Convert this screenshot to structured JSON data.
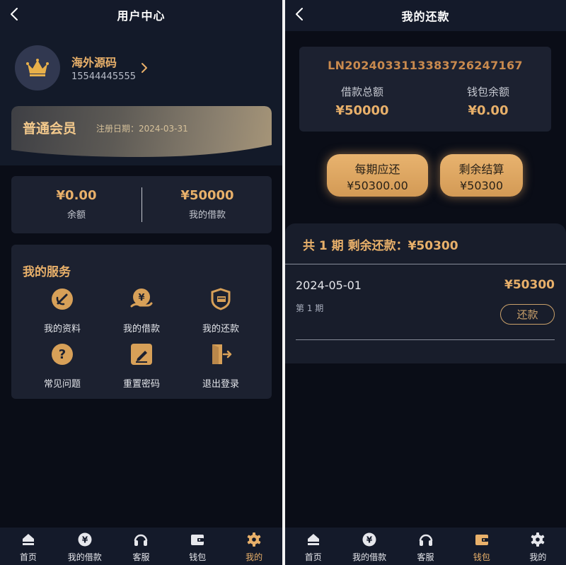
{
  "user_center": {
    "header": {
      "title": "用户中心"
    },
    "profile": {
      "name": "海外源码",
      "phone": "15544445555"
    },
    "membership": {
      "level": "普通会员",
      "reg_date": "注册日期：2024-03-31"
    },
    "balance": {
      "balance_value": "¥0.00",
      "balance_label": "余额",
      "loan_value": "¥50000",
      "loan_label": "我的借款"
    },
    "services": {
      "title": "我的服务",
      "items": [
        {
          "label": "我的资料",
          "icon": "profile-edit-icon"
        },
        {
          "label": "我的借款",
          "icon": "yen-hand-icon"
        },
        {
          "label": "我的还款",
          "icon": "card-shield-icon"
        },
        {
          "label": "常见问题",
          "icon": "question-icon"
        },
        {
          "label": "重置密码",
          "icon": "pencil-icon"
        },
        {
          "label": "退出登录",
          "icon": "logout-icon"
        }
      ]
    },
    "tabs": [
      {
        "label": "首页",
        "icon": "home-icon"
      },
      {
        "label": "我的借款",
        "icon": "yen-coin-icon"
      },
      {
        "label": "客服",
        "icon": "headset-icon"
      },
      {
        "label": "钱包",
        "icon": "wallet-icon"
      },
      {
        "label": "我的",
        "icon": "gear-icon",
        "active": true
      }
    ]
  },
  "my_repayment": {
    "header": {
      "title": "我的还款"
    },
    "loan": {
      "number": "LN2024033113383726247167",
      "total_label": "借款总额",
      "total_value": "¥50000",
      "wallet_label": "钱包余额",
      "wallet_value": "¥0.00"
    },
    "summary": {
      "per_period_label": "每期应还",
      "per_period_value": "¥50300.00",
      "remaining_label": "剩余结算",
      "remaining_value": "¥50300"
    },
    "schedule": {
      "heading": "共 1 期 剩余还款：¥50300",
      "items": [
        {
          "date": "2024-05-01",
          "amount": "¥50300",
          "period": "第 1 期",
          "action": "还款"
        }
      ]
    },
    "tabs": [
      {
        "label": "首页",
        "icon": "home-icon"
      },
      {
        "label": "我的借款",
        "icon": "yen-coin-icon"
      },
      {
        "label": "客服",
        "icon": "headset-icon"
      },
      {
        "label": "钱包",
        "icon": "wallet-icon",
        "active": true
      },
      {
        "label": "我的",
        "icon": "gear-icon"
      }
    ]
  },
  "colors": {
    "accent": "#e8b06a",
    "background": "#0a0d17",
    "card": "#1c2130"
  }
}
